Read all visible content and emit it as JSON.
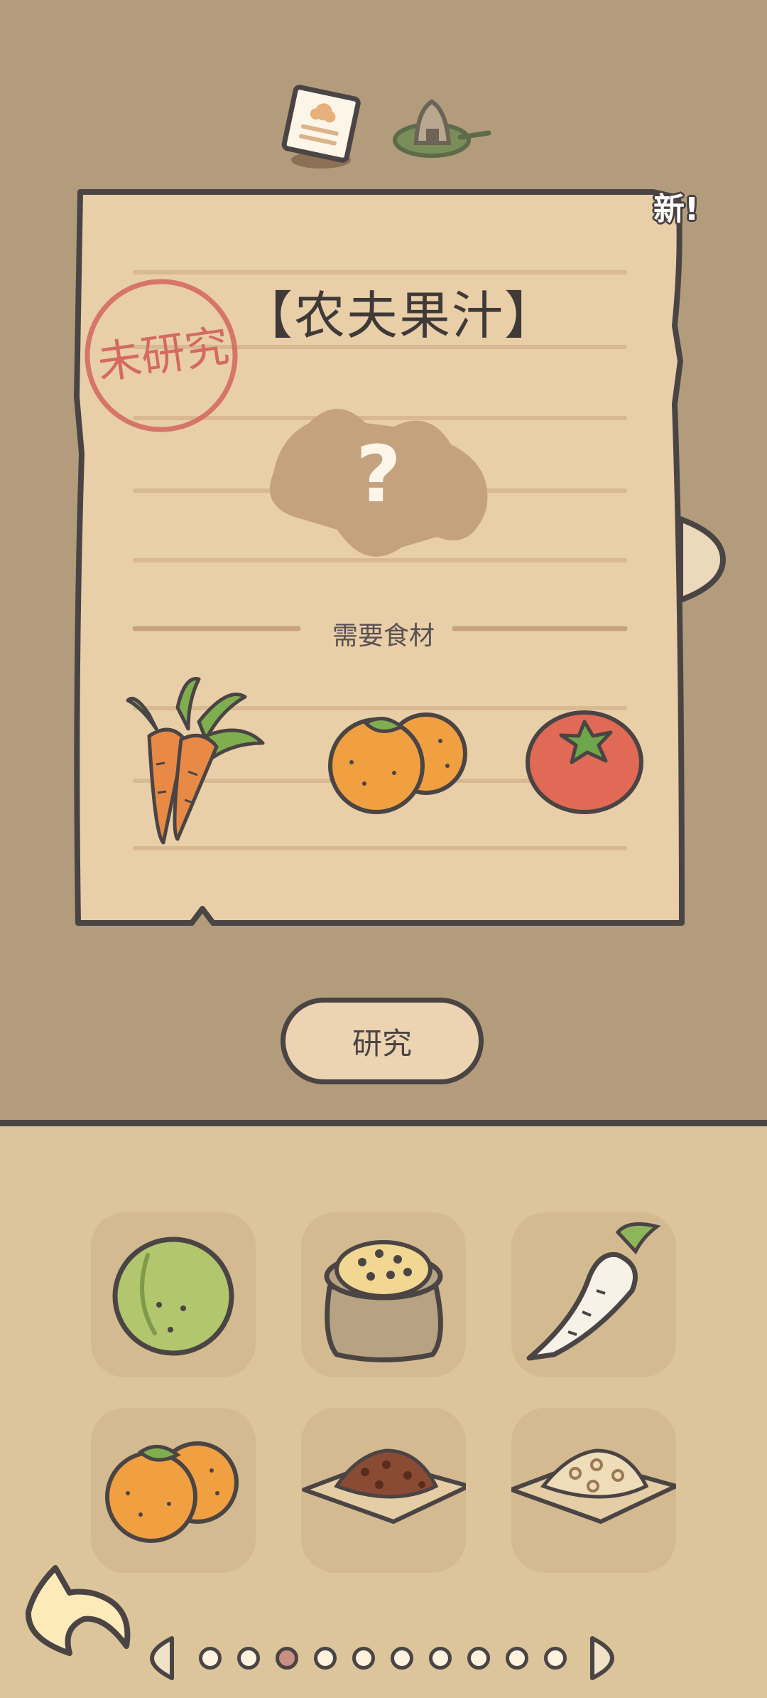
{
  "recipe": {
    "title": "【农夫果汁】",
    "stamp_text": "未研究",
    "new_badge": "新!",
    "unknown_symbol": "?",
    "need_label": "需要食材",
    "ingredients": [
      "carrot-icon",
      "mandarin-orange-icon",
      "tomato-icon"
    ]
  },
  "research_button": "研究",
  "inventory": {
    "items": [
      "green-apple-icon",
      "grain-sack-icon",
      "daikon-radish-icon",
      "mandarin-orange-icon",
      "minced-meat-icon",
      "minced-fish-icon"
    ]
  },
  "pagination": {
    "total_pages": 10,
    "current_page": 3
  },
  "colors": {
    "background": "#b39c7c",
    "paper": "#e8cfa8",
    "panel": "#dcc59a",
    "stamp": "#d46a62",
    "outline": "#4a4444"
  }
}
